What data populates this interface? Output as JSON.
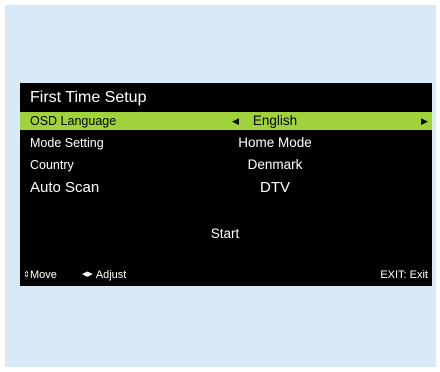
{
  "menu": {
    "title": "First Time Setup",
    "items": [
      {
        "label": "OSD Language",
        "value": "English"
      },
      {
        "label": "Mode Setting",
        "value": "Home Mode"
      },
      {
        "label": "Country",
        "value": "Denmark"
      },
      {
        "label": "Auto Scan",
        "value": "DTV"
      }
    ],
    "start_label": "Start"
  },
  "footer": {
    "move_label": "Move",
    "adjust_label": "Adjust",
    "exit_label": "EXIT: Exit"
  },
  "icons": {
    "left": "left-triangle-icon",
    "right": "right-triangle-icon",
    "move": "up-down-arrows-icon",
    "adjust": "left-right-arrows-icon"
  },
  "colors": {
    "backdrop": "#d8eaf8",
    "osd_background": "#000000",
    "highlight": "#9fd23b",
    "text": "#ffffff",
    "highlight_text": "#000000"
  }
}
